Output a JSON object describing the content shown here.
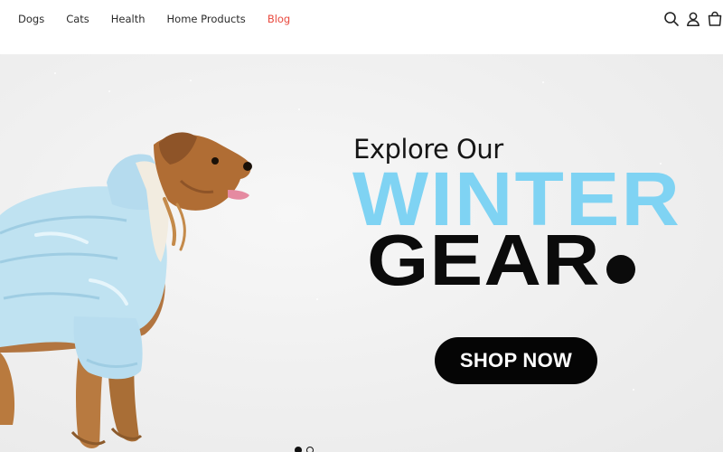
{
  "nav": {
    "items": [
      {
        "label": "Dogs"
      },
      {
        "label": "Cats"
      },
      {
        "label": "Health"
      },
      {
        "label": "Home Products"
      },
      {
        "label": "Blog",
        "active": true
      }
    ]
  },
  "header_icons": [
    "search-icon",
    "user-icon",
    "cart-icon"
  ],
  "hero": {
    "eyebrow": "Explore Our",
    "headline_line1": "WINTER",
    "headline_line2": "GEAR",
    "cta_label": "SHOP NOW",
    "slide_count": 2,
    "active_slide": 1
  },
  "colors": {
    "accent_blue": "#7fd3f3",
    "active_nav": "#e94a3f",
    "text_dark": "#0b0b0b",
    "hero_bg": "#efefef"
  }
}
